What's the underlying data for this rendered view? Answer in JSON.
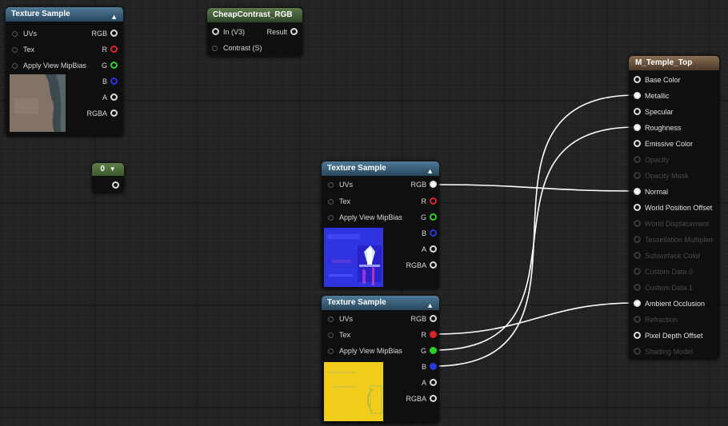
{
  "graph": {
    "texture_sample_top": {
      "title": "Texture Sample",
      "inputs": [
        "UVs",
        "Tex",
        "Apply View MipBias"
      ],
      "outputs": [
        "RGB",
        "R",
        "G",
        "B",
        "A",
        "RGBA"
      ]
    },
    "cheap_contrast": {
      "title": "CheapContrast_RGB",
      "input_a": "In (V3)",
      "output": "Result",
      "input_b": "Contrast (S)"
    },
    "constant": {
      "value": "0"
    },
    "texture_sample_normal": {
      "title": "Texture Sample",
      "inputs": [
        "UVs",
        "Tex",
        "Apply View MipBias"
      ],
      "outputs": [
        "RGB",
        "R",
        "G",
        "B",
        "A",
        "RGBA"
      ]
    },
    "texture_sample_masks": {
      "title": "Texture Sample",
      "inputs": [
        "UVs",
        "Tex",
        "Apply View MipBias"
      ],
      "outputs": [
        "RGB",
        "R",
        "G",
        "B",
        "A",
        "RGBA"
      ]
    },
    "material": {
      "title": "M_Temple_Top",
      "inputs": [
        "Base Color",
        "Metallic",
        "Specular",
        "Roughness",
        "Emissive Color",
        "Opacity",
        "Opacity Mask",
        "Normal",
        "World Position Offset",
        "World Displacement",
        "Tessellation Multiplier",
        "Subsurface Color",
        "Custom Data 0",
        "Custom Data 1",
        "Ambient Occlusion",
        "Refraction",
        "Pixel Depth Offset",
        "Shading Model"
      ]
    }
  },
  "colors": {
    "header_blue": "#3b6079",
    "header_green": "#4a6a3a",
    "header_brown": "#6e563f",
    "pin_red": "#e0232a",
    "pin_green": "#2bd22b",
    "pin_blue": "#2737e0",
    "wire": "#ffffff"
  }
}
